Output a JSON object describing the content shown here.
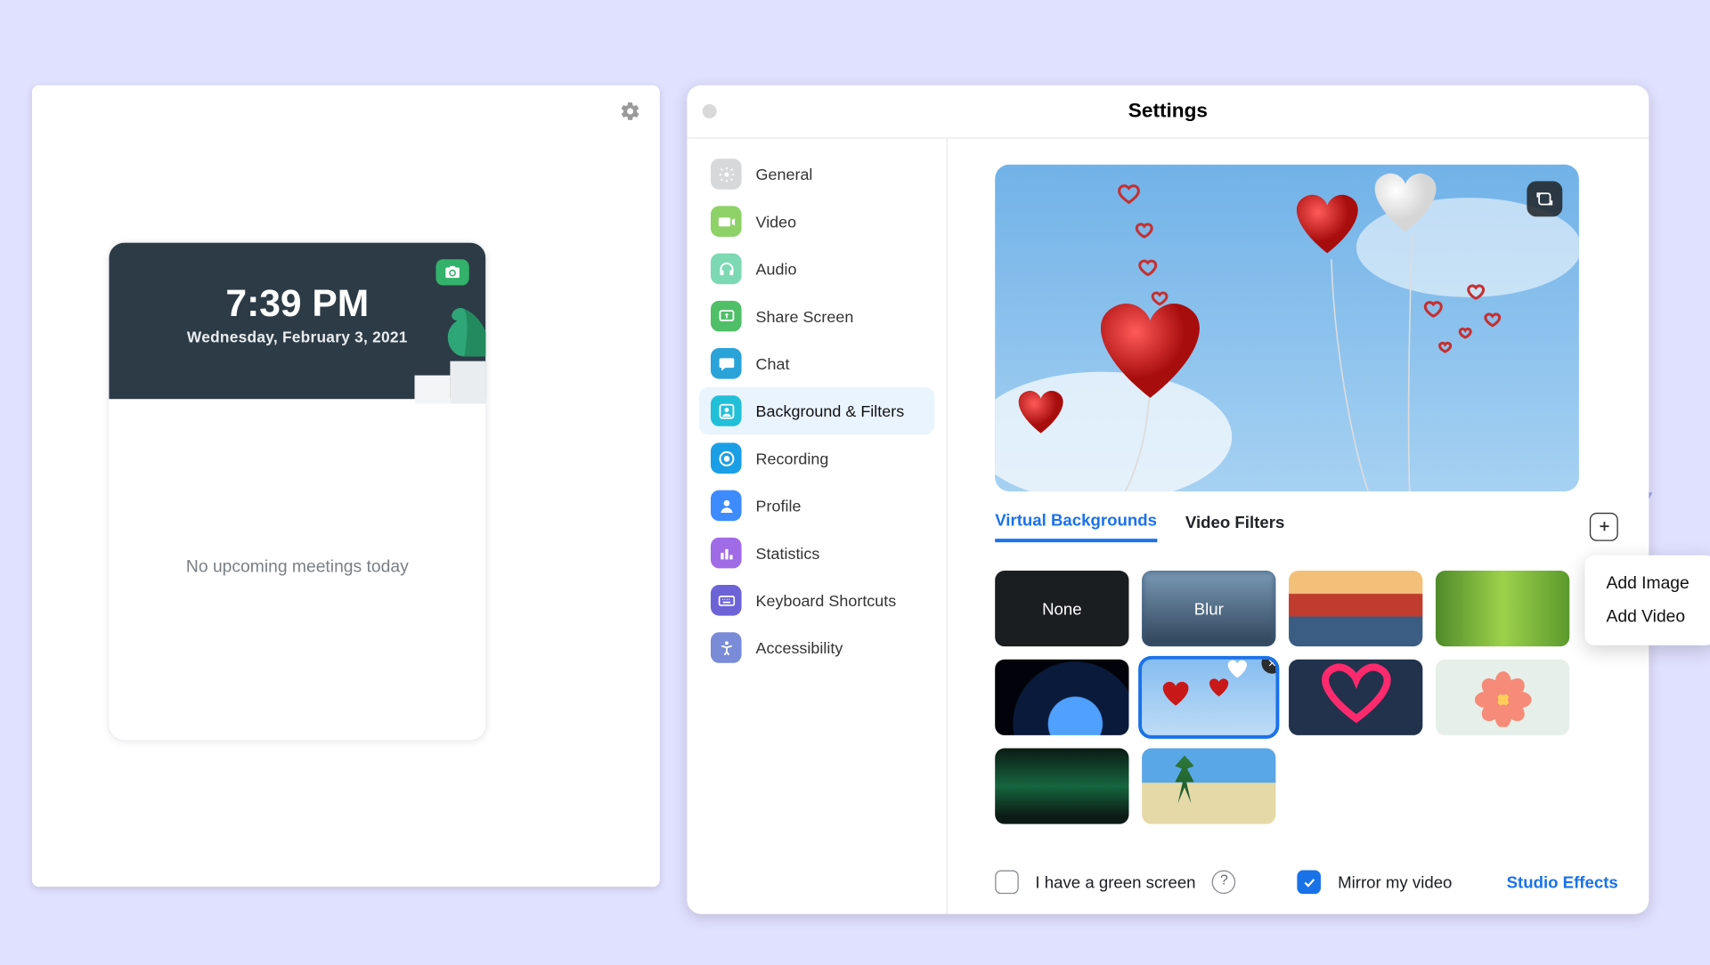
{
  "home": {
    "time": "7:39 PM",
    "date": "Wednesday, February 3, 2021",
    "no_meetings": "No upcoming meetings today"
  },
  "settings": {
    "title": "Settings",
    "sidebar": [
      {
        "id": "general",
        "label": "General"
      },
      {
        "id": "video",
        "label": "Video"
      },
      {
        "id": "audio",
        "label": "Audio"
      },
      {
        "id": "share",
        "label": "Share Screen"
      },
      {
        "id": "chat",
        "label": "Chat"
      },
      {
        "id": "bg",
        "label": "Background & Filters",
        "active": true
      },
      {
        "id": "rec",
        "label": "Recording"
      },
      {
        "id": "profile",
        "label": "Profile"
      },
      {
        "id": "stat",
        "label": "Statistics"
      },
      {
        "id": "kb",
        "label": "Keyboard Shortcuts"
      },
      {
        "id": "acc",
        "label": "Accessibility"
      }
    ],
    "tabs": {
      "virtual": "Virtual Backgrounds",
      "filters": "Video Filters"
    },
    "thumbs": {
      "none": "None",
      "blur": "Blur"
    },
    "footer": {
      "green_screen": "I have a green screen",
      "mirror": "Mirror my video",
      "studio": "Studio Effects"
    },
    "dropdown": {
      "add_image": "Add Image",
      "add_video": "Add Video"
    }
  }
}
